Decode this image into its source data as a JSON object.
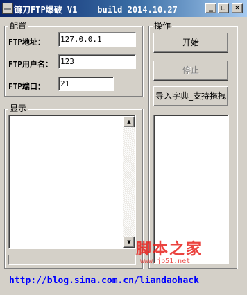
{
  "window": {
    "title": "镰刀FTP爆破 V1    build 2014.10.27",
    "minimize_glyph": "_",
    "maximize_glyph": "□",
    "close_glyph": "×"
  },
  "config": {
    "group_title": "配置",
    "address_label": "FTP地址：",
    "address_value": "127.0.0.1",
    "username_label": "FTP用户名：",
    "username_value": "123",
    "port_label": "FTP端口：",
    "port_value": "21"
  },
  "actions": {
    "group_title": "操作",
    "start_label": "开始",
    "stop_label": "停止",
    "import_label": "导入字典_支持拖拽"
  },
  "display": {
    "group_title": "显示",
    "up_arrow": "▲",
    "down_arrow": "▼"
  },
  "footer": {
    "link_text": "http://blog.sina.com.cn/liandaohack"
  },
  "watermark": {
    "text": "脚本之家",
    "url": "www.jb51.net"
  },
  "colors": {
    "window_bg": "#d4d0c8",
    "title_gradient_start": "#0a246a",
    "title_gradient_end": "#a6caf0",
    "link": "#0000ff",
    "watermark": "#e8231e"
  }
}
